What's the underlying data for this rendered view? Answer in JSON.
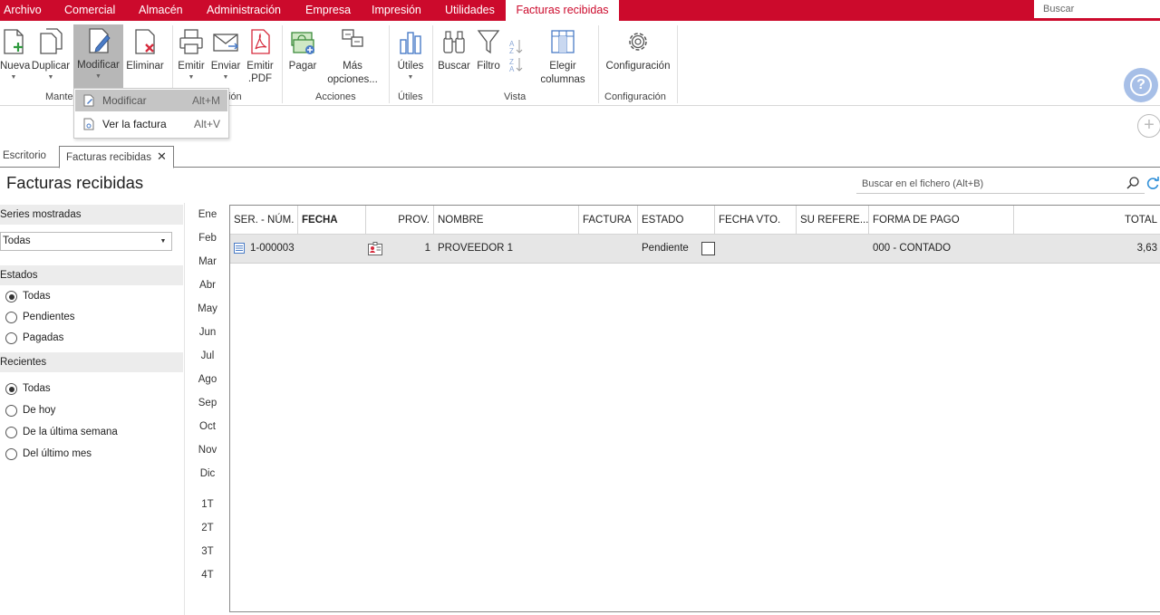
{
  "menubar": {
    "items": [
      "Archivo",
      "Comercial",
      "Almacén",
      "Administración",
      "Empresa",
      "Impresión",
      "Utilidades",
      "Facturas recibidas"
    ],
    "search_placeholder": "Buscar",
    "accent": "#cc0a2c"
  },
  "ribbon": {
    "buttons": {
      "nueva": "Nueva",
      "duplicar": "Duplicar",
      "modificar": "Modificar",
      "eliminar": "Eliminar",
      "emitir": "Emitir",
      "enviar": "Enviar",
      "emitir_pdf": "Emitir\n.PDF",
      "pagar": "Pagar",
      "mas_opciones": "Más\nopciones...",
      "utiles": "Útiles",
      "buscar": "Buscar",
      "filtro": "Filtro",
      "elegir_columnas": "Elegir\ncolumnas",
      "configuracion": "Configuración"
    },
    "groups": {
      "mantenimiento": "Mante",
      "emision": "ión",
      "acciones": "Acciones",
      "utiles": "Útiles",
      "vista": "Vista",
      "configuracion": "Configuración"
    },
    "help_icon": "question-icon"
  },
  "dropdown": {
    "items": [
      {
        "label": "Modificar",
        "shortcut": "Alt+M"
      },
      {
        "label": "Ver la factura",
        "shortcut": "Alt+V"
      }
    ]
  },
  "tabs": [
    {
      "label": "Escritorio"
    },
    {
      "label": "Facturas recibidas"
    }
  ],
  "page": {
    "title": "Facturas recibidas",
    "search_placeholder": "Buscar en el fichero (Alt+B)"
  },
  "filters": {
    "series": {
      "header": "Series mostradas",
      "selected": "Todas"
    },
    "estados": {
      "header": "Estados",
      "options": [
        "Todas",
        "Pendientes",
        "Pagadas"
      ],
      "selected": 0
    },
    "recientes": {
      "header": "Recientes",
      "options": [
        "Todas",
        "De hoy",
        "De la última semana",
        "Del último mes"
      ],
      "selected": 0
    }
  },
  "months": [
    "Ene",
    "Feb",
    "Mar",
    "Abr",
    "May",
    "Jun",
    "Jul",
    "Ago",
    "Sep",
    "Oct",
    "Nov",
    "Dic"
  ],
  "quarters": [
    "1T",
    "2T",
    "3T",
    "4T"
  ],
  "grid": {
    "columns": [
      "SER. - NÚM.",
      "FECHA",
      "PROV.",
      "NOMBRE",
      "FACTURA",
      "ESTADO",
      "FECHA VTO.",
      "SU REFERE...",
      "FORMA DE PAGO",
      "TOTAL"
    ],
    "rows": [
      {
        "ser_num": "1-000003",
        "fecha": "",
        "prov": "1",
        "nombre": "PROVEEDOR 1",
        "factura": "",
        "estado": "Pendiente",
        "fecha_vto": "",
        "su_ref": "",
        "forma_pago": "000 - CONTADO",
        "total": "3,63"
      }
    ]
  }
}
